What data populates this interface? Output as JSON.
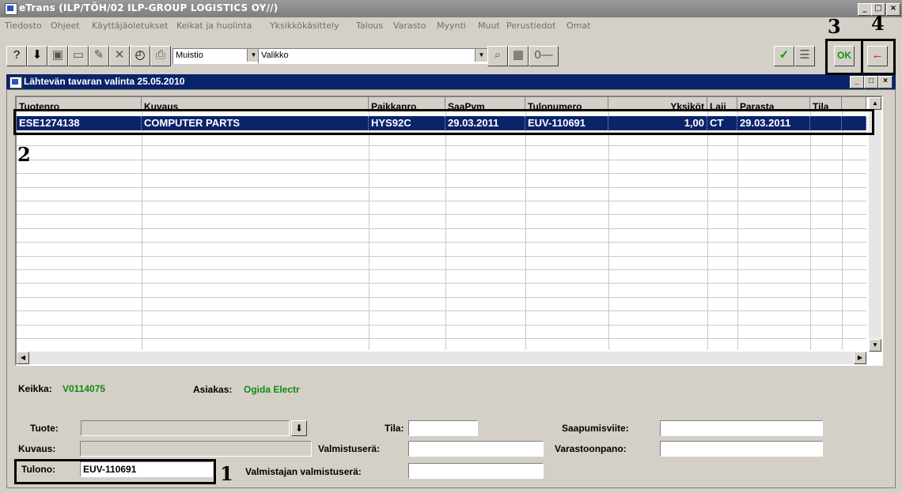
{
  "window": {
    "title": "eTrans (ILP/TÖH/02 ILP-GROUP LOGISTICS OY//)",
    "min_glyph": "_",
    "max_glyph": "□",
    "close_glyph": "×"
  },
  "menu": [
    "Tiedosto",
    "Ohjeet",
    "Käyttäjäoletukset",
    "Keikat ja huolinta",
    "Yksikkökäsittely",
    "Talous",
    "Varasto",
    "Myynti",
    "Muut",
    "Perustiedot",
    "Omat"
  ],
  "toolbar": {
    "combo1_value": "Muistio",
    "combo2_value": "Valikko",
    "ok_label": "OK",
    "accent_green": "#0a9a0a",
    "accent_red": "#d01010"
  },
  "child": {
    "title": "Lähtevän tavaran valinta 25.05.2010"
  },
  "grid": {
    "columns": [
      "Tuotenro",
      "Kuvaus",
      "Paikkanro",
      "SaaPvm",
      "Tulonumero",
      "Yksiköt",
      "Laji",
      "Parasta",
      "Tila"
    ],
    "rows": [
      [
        "ESE1274138",
        "COMPUTER PARTS",
        "HYS92C",
        "29.03.2011",
        "EUV-110691",
        "1,00",
        "CT",
        "29.03.2011",
        ""
      ]
    ],
    "selection_color": "#0a246a"
  },
  "info": {
    "keikka_label": "Keikka:",
    "keikka_value": "V0114075",
    "asiakas_label": "Asiakas:",
    "asiakas_value": "Ogida Electr"
  },
  "form": {
    "tuote_label": "Tuote:",
    "tuote_value": "",
    "kuvaus_label": "Kuvaus:",
    "kuvaus_value": "",
    "tulono_label": "Tulono:",
    "tulono_value": "EUV-110691",
    "tila_label": "Tila:",
    "tila_value": "",
    "valmistusera_label": "Valmistuserä:",
    "valmistusera_value": "",
    "valmistajan_label": "Valmistajan valmistuserä:",
    "valmistajan_value": "",
    "saapumisviite_label": "Saapumisviite:",
    "saapumisviite_value": "",
    "varastoonpano_label": "Varastoonpano:",
    "varastoonpano_value": ""
  },
  "annotations": [
    "1",
    "2",
    "3",
    "4"
  ]
}
